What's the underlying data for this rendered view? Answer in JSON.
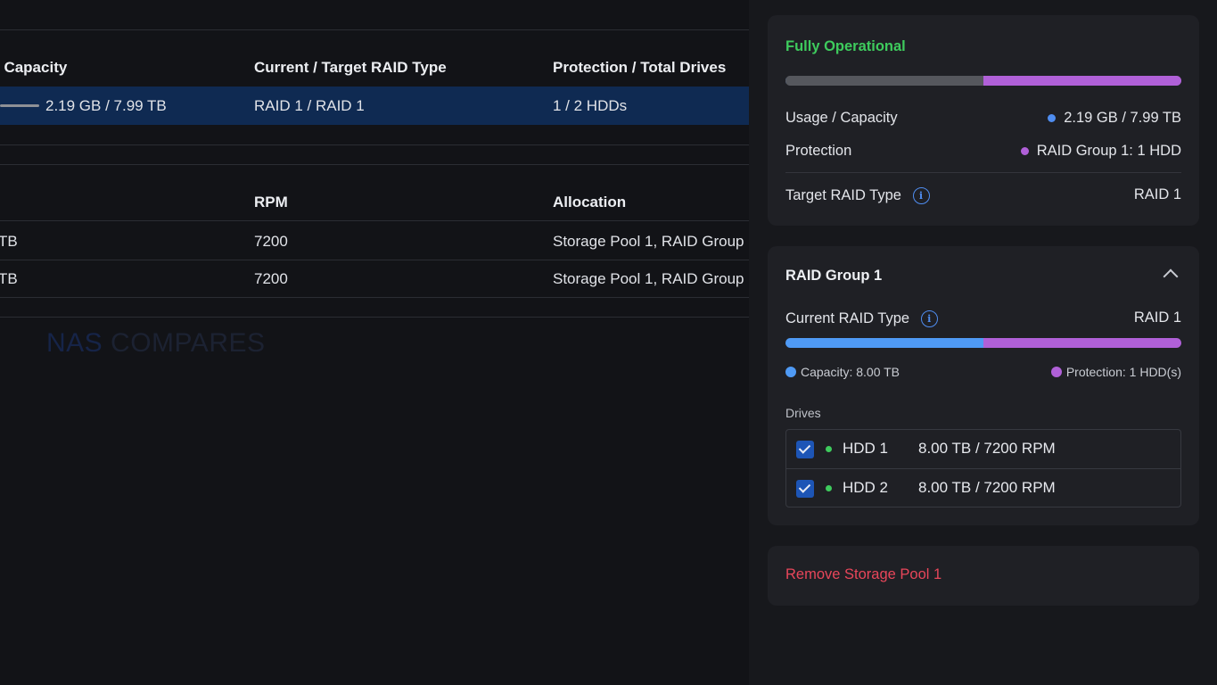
{
  "pool_table": {
    "headers": [
      "/ Capacity",
      "Current / Target RAID Type",
      "Protection / Total Drives"
    ],
    "rows": [
      {
        "usage": "2.19 GB / 7.99 TB",
        "raid": "RAID 1 / RAID 1",
        "protection": "1 / 2 HDDs",
        "selected": true
      }
    ]
  },
  "drive_table": {
    "headers": [
      "RPM",
      "Allocation"
    ],
    "rows": [
      {
        "size_fragment": "TB",
        "rpm": "7200",
        "allocation": "Storage Pool 1, RAID Group"
      },
      {
        "size_fragment": "TB",
        "rpm": "7200",
        "allocation": "Storage Pool 1, RAID Group"
      }
    ]
  },
  "watermark": {
    "part1": "NAS",
    "part2": "COMPARES"
  },
  "summary": {
    "status": "Fully Operational",
    "bar": {
      "usage_fraction": 0.0003,
      "protection_fraction": 0.5
    },
    "usage_label": "Usage / Capacity",
    "usage_value": "2.19 GB / 7.99 TB",
    "protection_label": "Protection",
    "protection_value": "RAID Group 1: 1 HDD",
    "target_raid_label": "Target RAID Type",
    "target_raid_value": "RAID 1"
  },
  "raid_group": {
    "title": "RAID Group 1",
    "current_raid_label": "Current RAID Type",
    "current_raid_value": "RAID 1",
    "bar": {
      "capacity_fraction": 0.5,
      "protection_fraction": 0.5
    },
    "capacity_legend": "Capacity: 8.00 TB",
    "protection_legend": "Protection: 1 HDD(s)",
    "drives_label": "Drives",
    "drives": [
      {
        "name": "HDD 1",
        "spec": "8.00 TB / 7200 RPM",
        "checked": true
      },
      {
        "name": "HDD 2",
        "spec": "8.00 TB / 7200 RPM",
        "checked": true
      }
    ]
  },
  "remove_label": "Remove Storage Pool 1",
  "colors": {
    "status_green": "#3ecb5d",
    "usage_blue": "#4f8df0",
    "protection_purple": "#b060d8",
    "remove_red": "#e8465a",
    "selected_row": "#0f2a52"
  }
}
